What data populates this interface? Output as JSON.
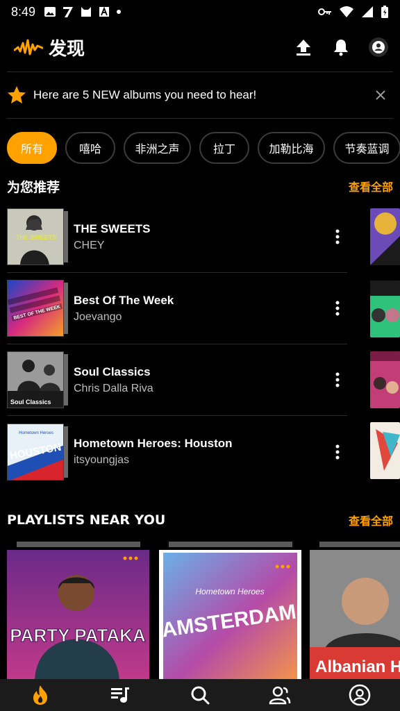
{
  "status_bar": {
    "time": "8:49"
  },
  "header": {
    "title": "发现"
  },
  "banner": {
    "text": "Here are 5 NEW albums you need to hear!"
  },
  "chips": [
    "所有",
    "嘻哈",
    "非洲之声",
    "拉丁",
    "加勒比海",
    "节奏蓝调"
  ],
  "recommended": {
    "title": "为您推荐",
    "see_all": "查看全部",
    "items": [
      {
        "title": "THE SWEETS",
        "artist": "CHEY",
        "cover_text": "THE SWEETS"
      },
      {
        "title": "Best Of The Week",
        "artist": "Joevango",
        "cover_text": "BEST OF THE WEEK"
      },
      {
        "title": "Soul Classics",
        "artist": "Chris Dalla Riva",
        "cover_text": "Soul Classics"
      },
      {
        "title": "Hometown Heroes: Houston",
        "artist": "itsyoungjas",
        "cover_text": "HOUSTON",
        "cover_sub": "Hometown Heroes"
      }
    ]
  },
  "playlists_near_you": {
    "title": "PLAYLISTS NEAR YOU",
    "see_all": "查看全部",
    "items": [
      {
        "cover_text": "PARTY PATAKA"
      },
      {
        "cover_text": "AMSTERDAM",
        "cover_sub": "Hometown Heroes"
      },
      {
        "cover_text": "Albanian Hits"
      }
    ]
  },
  "colors": {
    "accent": "#ffa200",
    "background": "#000000",
    "nav_bg": "#1b1b1b"
  },
  "icons": {
    "header": [
      "audiomack-logo",
      "upload-icon",
      "bell-icon",
      "account-icon"
    ],
    "bottom_nav": [
      "flame-icon",
      "playlist-icon",
      "search-icon",
      "people-icon",
      "account-circle-icon"
    ]
  }
}
